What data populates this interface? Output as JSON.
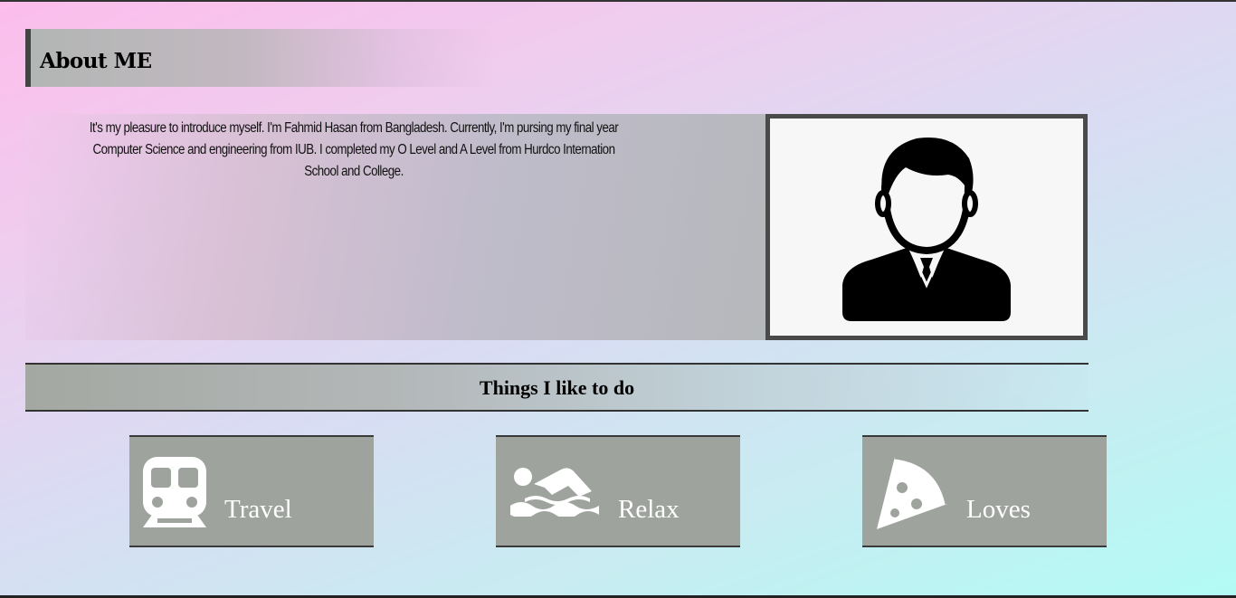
{
  "about": {
    "title": "About ME",
    "text": "It's my pleasure to introduce myself. I'm Fahmid Hasan from Bangladesh. Currently, I'm pursing my final year Computer Science and engineering from IUB. I completed my O Level and A Level from Hurdco Internation School and College.",
    "portrait_icon": "user-tie-icon"
  },
  "things": {
    "title": "Things I like to do",
    "cards": [
      {
        "label": "Travel",
        "icon": "subway-icon"
      },
      {
        "label": "Relax",
        "icon": "swimmer-icon"
      },
      {
        "label": "Loves",
        "icon": "pizza-slice-icon"
      }
    ]
  },
  "colors": {
    "card_bg": "#9fa39e",
    "card_text": "#ffffff",
    "frame_border": "#4a4a4a"
  }
}
